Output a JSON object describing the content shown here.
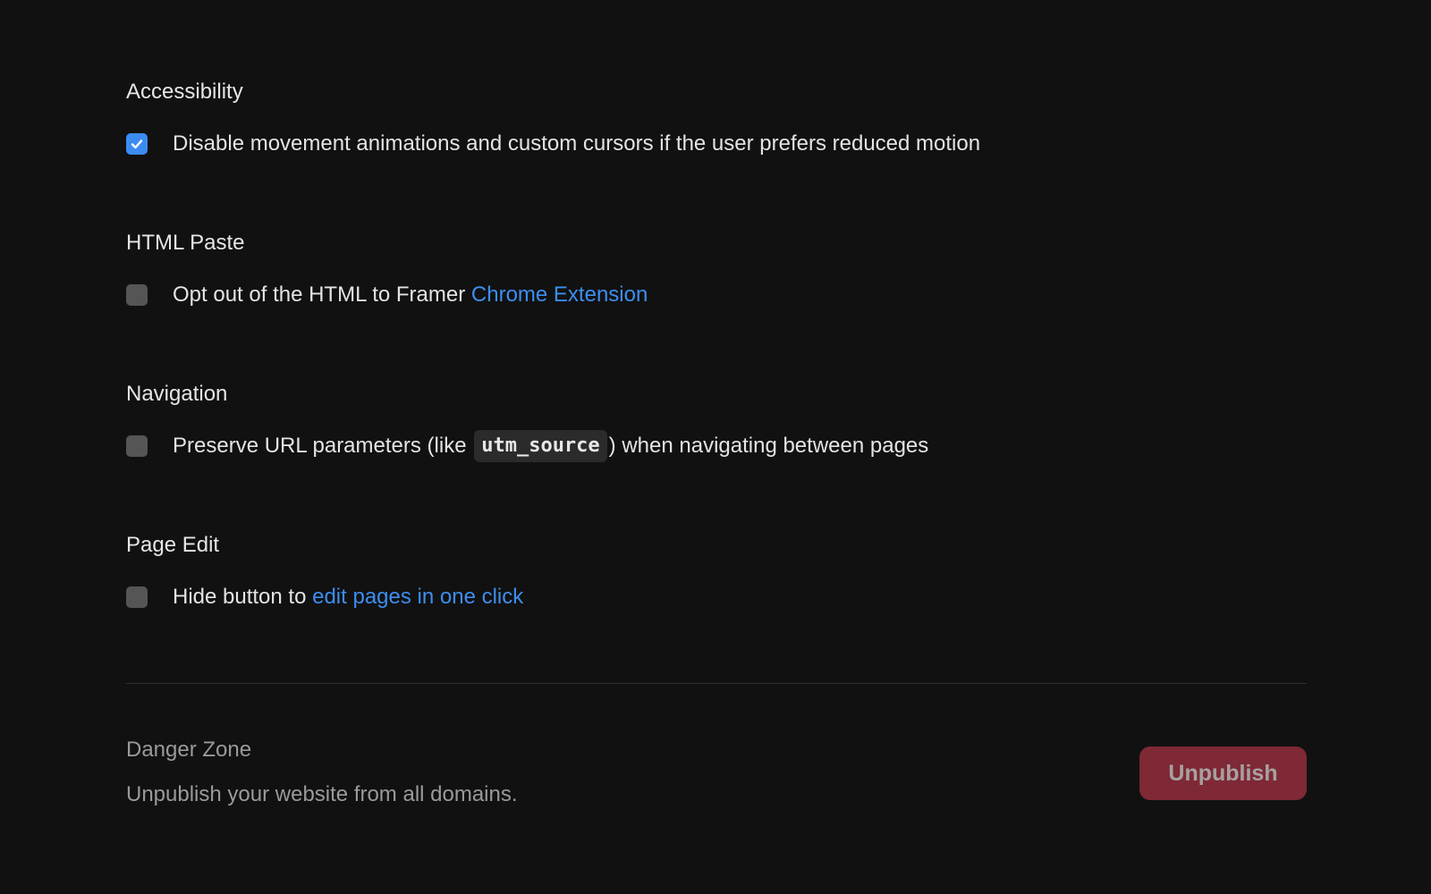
{
  "sections": [
    {
      "title": "Accessibility",
      "option": {
        "checked": true,
        "text": "Disable movement animations and custom cursors if the user prefers reduced motion"
      }
    },
    {
      "title": "HTML Paste",
      "option": {
        "checked": false,
        "text_before": "Opt out of the HTML to Framer ",
        "link_text": "Chrome Extension"
      }
    },
    {
      "title": "Navigation",
      "option": {
        "checked": false,
        "text_before": "Preserve URL parameters (like ",
        "code_text": "utm_source",
        "text_after": ") when navigating between pages"
      }
    },
    {
      "title": "Page Edit",
      "option": {
        "checked": false,
        "text_before": "Hide button to ",
        "link_text": "edit pages in one click"
      }
    }
  ],
  "danger_zone": {
    "title": "Danger Zone",
    "description": "Unpublish your website from all domains.",
    "button_label": "Unpublish"
  },
  "colors": {
    "background": "#111111",
    "checkbox_checked": "#3b8cf2",
    "checkbox_unchecked": "#555555",
    "link": "#3d8ef0",
    "danger_button": "#7e2935"
  },
  "icons": {
    "checked": "checkmark-icon"
  }
}
